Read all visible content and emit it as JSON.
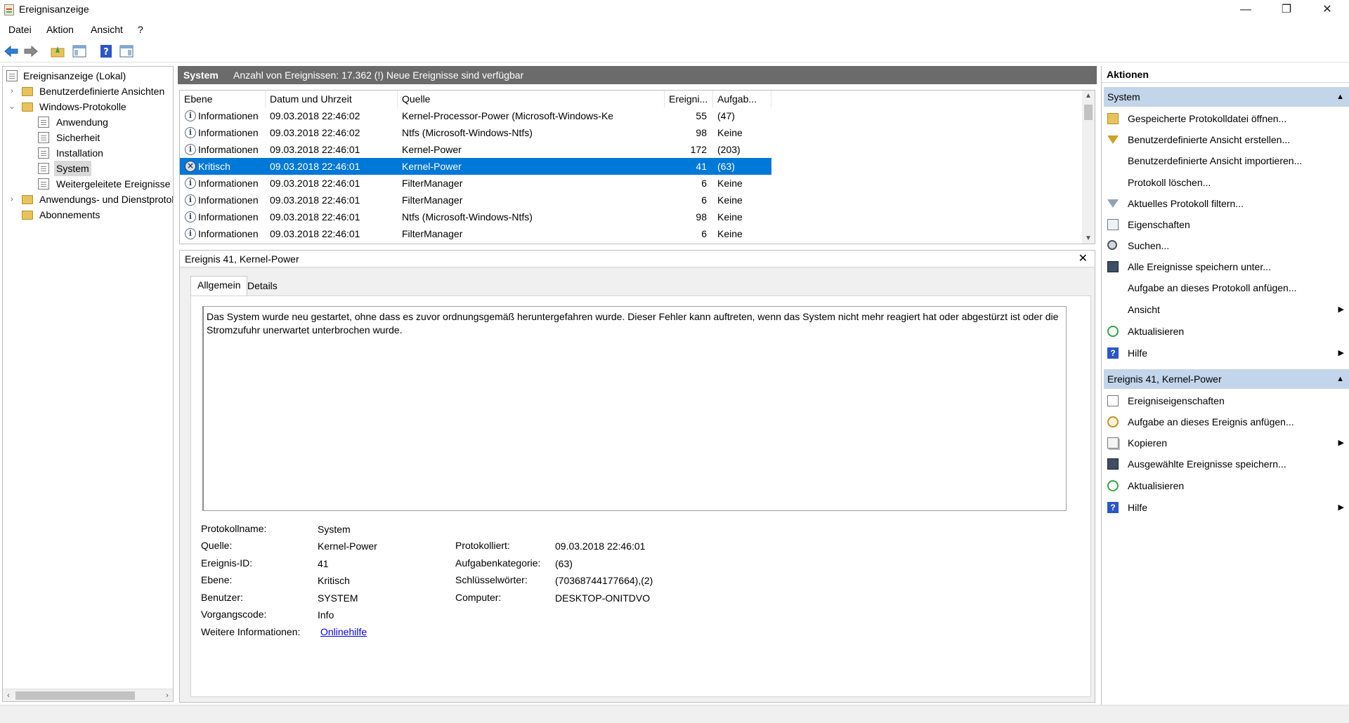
{
  "window": {
    "title": "Ereignisanzeige",
    "minimize": "—",
    "restore": "❐",
    "close": "✕"
  },
  "menu": [
    "Datei",
    "Aktion",
    "Ansicht",
    "?"
  ],
  "tree": {
    "items": [
      {
        "label": "Ereignisanzeige (Lokal)",
        "icon": "event-viewer-icon"
      },
      {
        "label": "Benutzerdefinierte Ansichten",
        "icon": "folder-icon",
        "expander": "›"
      },
      {
        "label": "Windows-Protokolle",
        "icon": "folder-icon",
        "expander": "⌄"
      },
      {
        "label": "Anwendung",
        "icon": "log-icon"
      },
      {
        "label": "Sicherheit",
        "icon": "log-icon"
      },
      {
        "label": "Installation",
        "icon": "log-icon"
      },
      {
        "label": "System",
        "icon": "log-icon",
        "selected": true
      },
      {
        "label": "Weitergeleitete Ereignisse",
        "icon": "log-icon"
      },
      {
        "label": "Anwendungs- und Dienstprotokolle",
        "icon": "folder-icon",
        "expander": "›"
      },
      {
        "label": "Abonnements",
        "icon": "subscription-icon"
      }
    ]
  },
  "center": {
    "header_title": "System",
    "header_info": "Anzahl von Ereignissen: 17.362 (!) Neue Ereignisse sind verfügbar"
  },
  "events": {
    "columns": [
      "Ebene",
      "Datum und Uhrzeit",
      "Quelle",
      "Ereigni...",
      "Aufgab..."
    ],
    "rows": [
      {
        "level": "Informationen",
        "date": "09.03.2018 22:46:02",
        "source": "Kernel-Processor-Power (Microsoft-Windows-Kernel-...",
        "id": "55",
        "task": "(47)",
        "critical": false
      },
      {
        "level": "Informationen",
        "date": "09.03.2018 22:46:02",
        "source": "Ntfs (Microsoft-Windows-Ntfs)",
        "id": "98",
        "task": "Keine",
        "critical": false
      },
      {
        "level": "Informationen",
        "date": "09.03.2018 22:46:01",
        "source": "Kernel-Power",
        "id": "172",
        "task": "(203)",
        "critical": false
      },
      {
        "level": "Kritisch",
        "date": "09.03.2018 22:46:01",
        "source": "Kernel-Power",
        "id": "41",
        "task": "(63)",
        "critical": true
      },
      {
        "level": "Informationen",
        "date": "09.03.2018 22:46:01",
        "source": "FilterManager",
        "id": "6",
        "task": "Keine",
        "critical": false
      },
      {
        "level": "Informationen",
        "date": "09.03.2018 22:46:01",
        "source": "FilterManager",
        "id": "6",
        "task": "Keine",
        "critical": false
      },
      {
        "level": "Informationen",
        "date": "09.03.2018 22:46:01",
        "source": "Ntfs (Microsoft-Windows-Ntfs)",
        "id": "98",
        "task": "Keine",
        "critical": false
      },
      {
        "level": "Informationen",
        "date": "09.03.2018 22:46:01",
        "source": "FilterManager",
        "id": "6",
        "task": "Keine",
        "critical": false
      }
    ]
  },
  "detail": {
    "title": "Ereignis 41, Kernel-Power",
    "tabs": [
      "Allgemein",
      "Details"
    ],
    "message": "Das System wurde neu gestartet, ohne dass es zuvor ordnungsgemäß heruntergefahren wurde. Dieser Fehler kann auftreten, wenn das System nicht mehr reagiert hat oder abgestürzt ist oder die Stromzufuhr unerwartet unterbrochen wurde.",
    "labels": {
      "protokollname": "Protokollname:",
      "quelle": "Quelle:",
      "ereignis_id": "Ereignis-ID:",
      "ebene": "Ebene:",
      "benutzer": "Benutzer:",
      "vorgangscode": "Vorgangscode:",
      "weitere": "Weitere Informationen:",
      "protokolliert": "Protokolliert:",
      "aufgabenkategorie": "Aufgabenkategorie:",
      "schluesselwoerter": "Schlüsselwörter:",
      "computer": "Computer:"
    },
    "values": {
      "protokollname": "System",
      "quelle": "Kernel-Power",
      "ereignis_id": "41",
      "ebene": "Kritisch",
      "benutzer": "SYSTEM",
      "vorgangscode": "Info",
      "weitere": "Onlinehilfe",
      "protokolliert": "09.03.2018 22:46:01",
      "aufgabenkategorie": "(63)",
      "schluesselwoerter": "(70368744177664),(2)",
      "computer": "DESKTOP-ONITDVO"
    }
  },
  "actions": {
    "title": "Aktionen",
    "section1": "System",
    "section1_items": [
      {
        "label": "Gespeicherte Protokolldatei öffnen...",
        "icon": "open-folder-icon"
      },
      {
        "label": "Benutzerdefinierte Ansicht erstellen...",
        "icon": "filter-icon"
      },
      {
        "label": "Benutzerdefinierte Ansicht importieren...",
        "icon": ""
      },
      {
        "label": "Protokoll löschen...",
        "icon": ""
      },
      {
        "label": "Aktuelles Protokoll filtern...",
        "icon": "filter-icon"
      },
      {
        "label": "Eigenschaften",
        "icon": "properties-icon"
      },
      {
        "label": "Suchen...",
        "icon": "binoculars-icon"
      },
      {
        "label": "Alle Ereignisse speichern unter...",
        "icon": "save-icon"
      },
      {
        "label": "Aufgabe an dieses Protokoll anfügen...",
        "icon": ""
      },
      {
        "label": "Ansicht",
        "icon": "",
        "submenu": true
      },
      {
        "label": "Aktualisieren",
        "icon": "refresh-icon"
      },
      {
        "label": "Hilfe",
        "icon": "help-icon",
        "submenu": true
      }
    ],
    "section2": "Ereignis 41, Kernel-Power",
    "section2_items": [
      {
        "label": "Ereigniseigenschaften",
        "icon": "event-properties-icon"
      },
      {
        "label": "Aufgabe an dieses Ereignis anfügen...",
        "icon": "task-icon"
      },
      {
        "label": "Kopieren",
        "icon": "copy-icon",
        "submenu": true
      },
      {
        "label": "Ausgewählte Ereignisse speichern...",
        "icon": "save-icon"
      },
      {
        "label": "Aktualisieren",
        "icon": "refresh-icon"
      },
      {
        "label": "Hilfe",
        "icon": "help-icon",
        "submenu": true
      }
    ]
  }
}
